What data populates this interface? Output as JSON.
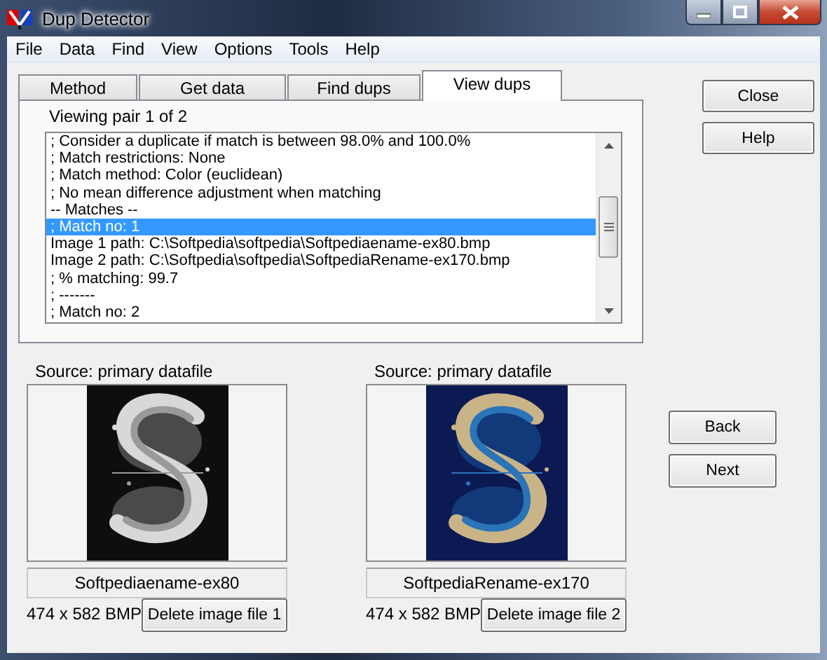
{
  "window": {
    "title": "Dup Detector"
  },
  "menu": [
    "File",
    "Data",
    "Find",
    "View",
    "Options",
    "Tools",
    "Help"
  ],
  "tabs": [
    {
      "label": "Method",
      "selected": false
    },
    {
      "label": "Get data",
      "selected": false
    },
    {
      "label": "Find dups",
      "selected": false
    },
    {
      "label": "View dups",
      "selected": true
    }
  ],
  "pair_label": "Viewing pair 1 of 2",
  "listing": [
    {
      "text": "; Consider a duplicate if match is between 98.0% and 100.0%",
      "selected": false
    },
    {
      "text": "; Match restrictions: None",
      "selected": false
    },
    {
      "text": "; Match method: Color (euclidean)",
      "selected": false
    },
    {
      "text": "; No mean difference adjustment when matching",
      "selected": false
    },
    {
      "text": "-- Matches --",
      "selected": false
    },
    {
      "text": "; Match no: 1",
      "selected": true
    },
    {
      "text": "Image 1 path: C:\\Softpedia\\softpedia\\Softpediaename-ex80.bmp",
      "selected": false
    },
    {
      "text": "Image 2 path: C:\\Softpedia\\softpedia\\SoftpediaRename-ex170.bmp",
      "selected": false
    },
    {
      "text": "; % matching: 99.7",
      "selected": false
    },
    {
      "text": "; -------",
      "selected": false
    },
    {
      "text": "; Match no: 2",
      "selected": false
    }
  ],
  "side_buttons": [
    "Close",
    "Help"
  ],
  "images": [
    {
      "source": "Source: primary datafile",
      "name": "Softpediaename-ex80",
      "info": "474 x 582 BMP",
      "delete_button": "Delete image file 1"
    },
    {
      "source": "Source: primary datafile",
      "name": "SoftpediaRename-ex170",
      "info": "474 x 582 BMP",
      "delete_button": "Delete image file 2"
    }
  ],
  "nav_buttons": [
    "Back",
    "Next"
  ]
}
